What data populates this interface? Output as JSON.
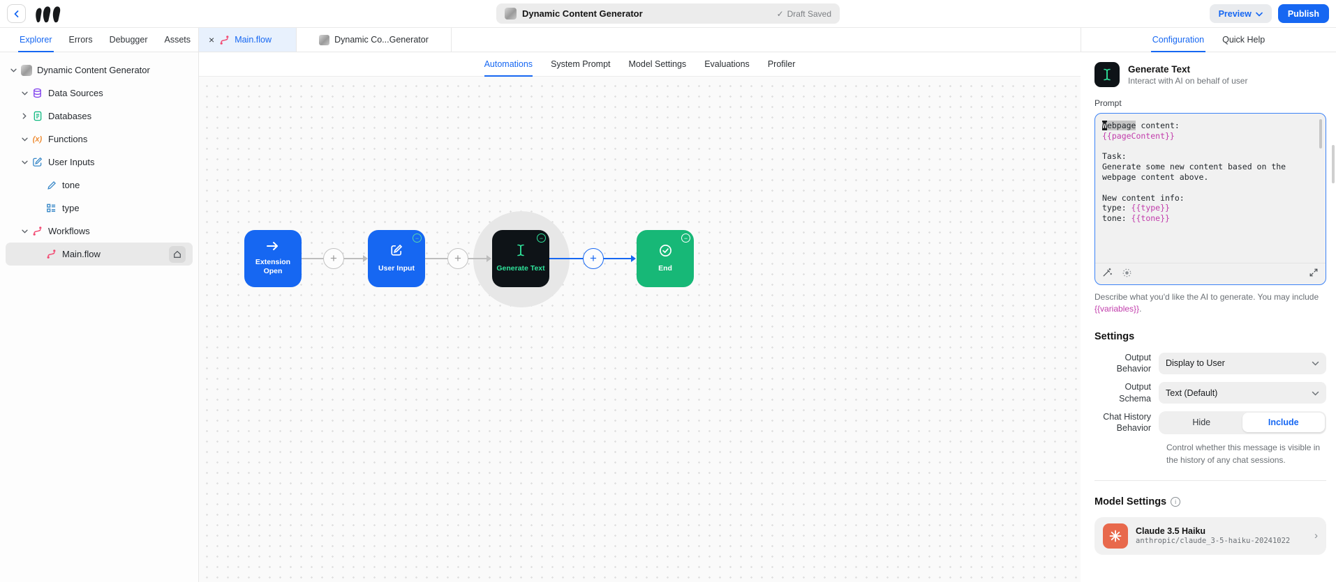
{
  "colors": {
    "accent_blue": "#1667f2",
    "active_tab_bg": "#e8f1fd",
    "node_dark": "#0e1317",
    "node_green": "#17b877",
    "icon_green": "#2fe39b",
    "flow_pink": "#f24a72",
    "variable_pink": "#c13cab",
    "anthropic_coral": "#e8694c"
  },
  "header": {
    "title": "Dynamic Content Generator",
    "draft_status": "Draft Saved",
    "draft_check": "✓",
    "preview_label": "Preview",
    "publish_label": "Publish"
  },
  "sidebar": {
    "tabs": [
      {
        "label": "Explorer"
      },
      {
        "label": "Errors"
      },
      {
        "label": "Debugger"
      },
      {
        "label": "Assets"
      }
    ],
    "tree": [
      {
        "label": "Dynamic Content Generator"
      },
      {
        "label": "Data Sources"
      },
      {
        "label": "Databases"
      },
      {
        "label": "Functions"
      },
      {
        "label": "User Inputs"
      },
      {
        "label": "tone"
      },
      {
        "label": "type"
      },
      {
        "label": "Workflows"
      },
      {
        "label": "Main.flow"
      }
    ],
    "functions_glyph": "(x)"
  },
  "file_tabs": [
    {
      "label": "Main.flow",
      "close": "×"
    },
    {
      "label": "Dynamic Co...Generator"
    }
  ],
  "canvas": {
    "tabs": [
      {
        "label": "Automations"
      },
      {
        "label": "System Prompt"
      },
      {
        "label": "Model Settings"
      },
      {
        "label": "Evaluations"
      },
      {
        "label": "Profiler"
      }
    ],
    "nodes": [
      {
        "label": "Extension Open"
      },
      {
        "label": "User Input"
      },
      {
        "label": "Generate Text"
      },
      {
        "label": "End"
      }
    ],
    "plus_glyph": "+",
    "badge_glyph": "−"
  },
  "config": {
    "tabs": [
      {
        "label": "Configuration"
      },
      {
        "label": "Quick Help"
      }
    ],
    "node_title": "Generate Text",
    "node_subtitle": "Interact with AI on behalf of user",
    "prompt": {
      "label": "Prompt",
      "line1_cursor": "W",
      "line1_selected": "ebpage",
      "line1_rest": " content:",
      "line2_var": "{{pageContent}}",
      "line4": "Task:",
      "line5": "Generate some new content based on the",
      "line6": "webpage content above.",
      "line8": "New content info:",
      "line9_text": "type: ",
      "line9_var": "{{type}}",
      "line10_text": "tone: ",
      "line10_var": "{{tone}}",
      "help_text": "Describe what you'd like the AI to generate. You may include ",
      "help_var": "{{variables}}",
      "help_end": "."
    },
    "settings": {
      "heading": "Settings",
      "output_behavior_label": "Output Behavior",
      "output_behavior_value": "Display to User",
      "output_schema_label": "Output Schema",
      "output_schema_value": "Text (Default)",
      "chat_history_label": "Chat History Behavior",
      "hide_label": "Hide",
      "include_label": "Include",
      "chat_history_help": "Control whether this message is visible in the history of any chat sessions."
    },
    "model_settings": {
      "heading": "Model Settings",
      "info_glyph": "i",
      "model_name": "Claude 3.5 Haiku",
      "model_id": "anthropic/claude_3-5-haiku-20241022",
      "chevron": "›"
    }
  }
}
